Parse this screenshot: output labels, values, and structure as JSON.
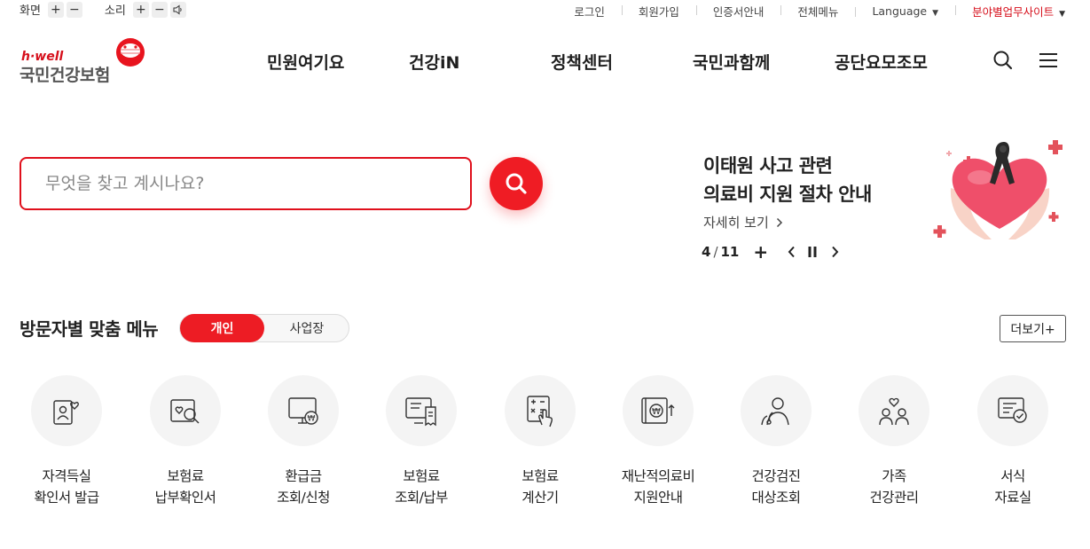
{
  "util": {
    "screen_label": "화면",
    "sound_label": "소리",
    "plus": "+",
    "minus": "−",
    "links": [
      "로그인",
      "회원가입",
      "인증서안내",
      "전체메뉴"
    ],
    "language": "Language",
    "family_sites": "분야별업무사이트"
  },
  "logo": {
    "tagline": "h·well",
    "name": "국민건강보험"
  },
  "gnb": [
    "민원여기요",
    "건강iN",
    "정책센터",
    "국민과함께",
    "공단요모조모"
  ],
  "search": {
    "placeholder": "무엇을 찾고 계시나요?"
  },
  "banner": {
    "title_line1": "이태원 사고 관련",
    "title_line2": "의료비 지원 절차 안내",
    "more": "자세히 보기",
    "current": "4",
    "divider": "/",
    "total": "11",
    "plus": "+"
  },
  "visitor_menu": {
    "title": "방문자별 맞춤 메뉴",
    "tab_personal": "개인",
    "tab_business": "사업장",
    "more": "더보기+",
    "items": [
      {
        "icon": "person-heart-icon",
        "line1": "자격득실",
        "line2": "확인서 발급"
      },
      {
        "icon": "heart-search-icon",
        "line1": "보험료",
        "line2": "납부확인서"
      },
      {
        "icon": "monitor-won-icon",
        "line1": "환급금",
        "line2": "조회/신청"
      },
      {
        "icon": "monitor-receipt-icon",
        "line1": "보험료",
        "line2": "조회/납부"
      },
      {
        "icon": "calculator-hand-icon",
        "line1": "보험료",
        "line2": "계산기"
      },
      {
        "icon": "won-up-icon",
        "line1": "재난적의료비",
        "line2": "지원안내"
      },
      {
        "icon": "doctor-icon",
        "line1": "건강검진",
        "line2": "대상조회"
      },
      {
        "icon": "family-heart-icon",
        "line1": "가족",
        "line2": "건강관리"
      },
      {
        "icon": "document-check-icon",
        "line1": "서식",
        "line2": "자료실"
      }
    ]
  },
  "colors": {
    "brand_red": "#ed1c24",
    "border_red": "#e0101c",
    "text_dark": "#222222"
  }
}
